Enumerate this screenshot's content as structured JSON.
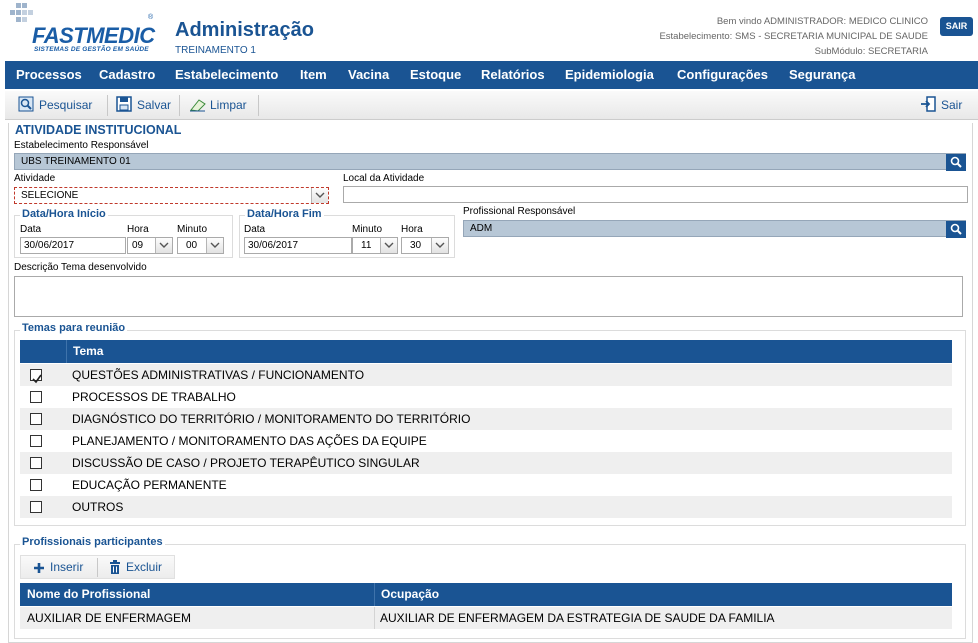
{
  "header": {
    "logo_text": "FASTMEDIC",
    "logo_tagline": "SISTEMAS DE GESTÃO EM SAÚDE",
    "logo_reg": "®",
    "title": "Administração",
    "subtitle": "TREINAMENTO 1",
    "welcome": "Bem vindo ADMINISTRADOR: MEDICO CLINICO",
    "establishment": "Estabelecimento: SMS - SECRETARIA MUNICIPAL DE SAUDE",
    "submodule": "SubMódulo: SECRETARIA",
    "logout_label": "SAIR"
  },
  "menu": [
    "Processos",
    "Cadastro",
    "Estabelecimento",
    "Item",
    "Vacina",
    "Estoque",
    "Relatórios",
    "Epidemiologia",
    "Configurações",
    "Segurança"
  ],
  "toolbar": {
    "search_label": "Pesquisar",
    "save_label": "Salvar",
    "clear_label": "Limpar",
    "exit_label": "Sair"
  },
  "form": {
    "section_title": "ATIVIDADE INSTITUCIONAL",
    "estab_label": "Estabelecimento Responsável",
    "estab_value": "UBS TREINAMENTO 01",
    "atividade_label": "Atividade",
    "atividade_value": "SELECIONE",
    "local_label": "Local da Atividade",
    "local_value": "",
    "inicio_group": "Data/Hora Início",
    "fim_group": "Data/Hora Fim",
    "data_label": "Data",
    "hora_label": "Hora",
    "minuto_label": "Minuto",
    "inicio_data": "30/06/2017",
    "inicio_hora": "09",
    "inicio_minuto": "00",
    "fim_data": "30/06/2017",
    "fim_minuto": "11",
    "fim_hora": "30",
    "prof_label": "Profissional Responsável",
    "prof_value": "ADM",
    "descricao_label": "Descrição Tema desenvolvido",
    "descricao_value": ""
  },
  "temas": {
    "group_title": "Temas para reunião",
    "column": "Tema",
    "items": [
      {
        "label": "QUESTÕES ADMINISTRATIVAS / FUNCIONAMENTO",
        "checked": true
      },
      {
        "label": "PROCESSOS DE TRABALHO",
        "checked": false
      },
      {
        "label": "DIAGNÓSTICO DO TERRITÓRIO / MONITORAMENTO DO TERRITÓRIO",
        "checked": false
      },
      {
        "label": "PLANEJAMENTO / MONITORAMENTO DAS AÇÕES DA EQUIPE",
        "checked": false
      },
      {
        "label": "DISCUSSÃO DE CASO / PROJETO TERAPÊUTICO SINGULAR",
        "checked": false
      },
      {
        "label": "EDUCAÇÃO PERMANENTE",
        "checked": false
      },
      {
        "label": "OUTROS",
        "checked": false
      }
    ]
  },
  "participantes": {
    "group_title": "Profissionais participantes",
    "insert_label": "Inserir",
    "delete_label": "Excluir",
    "columns": [
      "Nome do Profissional",
      "Ocupação"
    ],
    "rows": [
      {
        "nome": "AUXILIAR DE ENFERMAGEM",
        "ocupacao": "AUXILIAR DE ENFERMAGEM DA ESTRATEGIA DE SAUDE DA FAMILIA"
      }
    ]
  },
  "colors": {
    "primary": "#1a5493",
    "readonly": "#b7c7d6",
    "row_alt": "#efefef"
  }
}
